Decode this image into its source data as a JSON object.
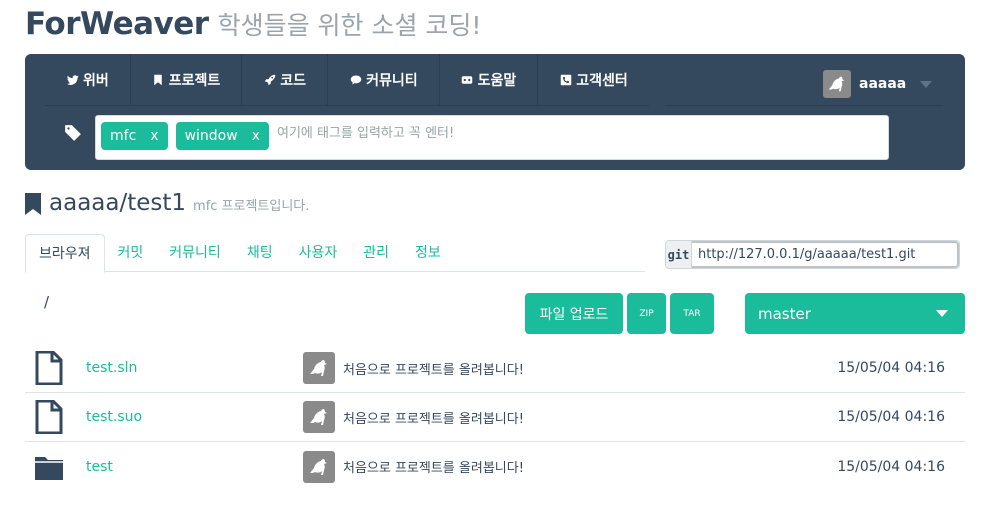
{
  "header": {
    "brand": "ForWeaver",
    "tagline": "학생들을 위한 소셜 코딩!"
  },
  "nav": {
    "items": [
      {
        "label": "위버",
        "icon": "twitter-icon"
      },
      {
        "label": "프로젝트",
        "icon": "bookmark-icon"
      },
      {
        "label": "코드",
        "icon": "rocket-icon"
      },
      {
        "label": "커뮤니티",
        "icon": "comments-icon"
      },
      {
        "label": "도움말",
        "icon": "gamepad-icon"
      },
      {
        "label": "고객센터",
        "icon": "phone-icon"
      }
    ],
    "user": {
      "name": "aaaaa"
    }
  },
  "tags": {
    "chips": [
      {
        "label": "mfc",
        "remove": "x"
      },
      {
        "label": "window",
        "remove": "x"
      }
    ],
    "placeholder": "여기에 태그를 입력하고 꼭 엔터!"
  },
  "repo": {
    "name": "aaaaa/test1",
    "description": "mfc 프로젝트입니다."
  },
  "tabs": [
    "브라우져",
    "커밋",
    "커뮤니티",
    "채팅",
    "사용자",
    "관리",
    "정보"
  ],
  "git": {
    "label": "git",
    "url": "http://127.0.0.1/g/aaaaa/test1.git"
  },
  "browser": {
    "path": "/",
    "upload_label": "파일 업로드",
    "zip_label": "ZIP",
    "tar_label": "TAR",
    "branch": "master",
    "files": [
      {
        "name": "test.sln",
        "type": "file",
        "message": "처음으로 프로젝트를 올려봅니다!",
        "date": "15/05/04 04:16"
      },
      {
        "name": "test.suo",
        "type": "file",
        "message": "처음으로 프로젝트를 올려봅니다!",
        "date": "15/05/04 04:16"
      },
      {
        "name": "test",
        "type": "folder",
        "message": "처음으로 프로젝트를 올려봅니다!",
        "date": "15/05/04 04:16"
      }
    ]
  },
  "colors": {
    "primary": "#34495e",
    "accent": "#1abc9c",
    "muted": "#95a5a6"
  }
}
